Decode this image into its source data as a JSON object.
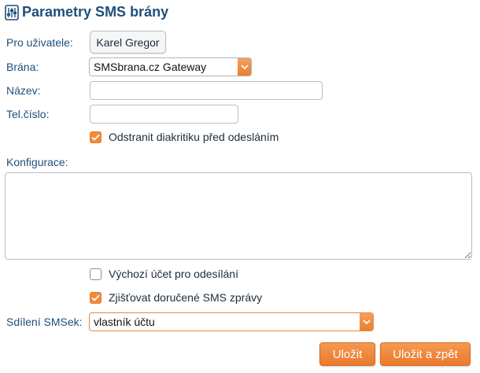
{
  "header": {
    "title": "Parametry SMS brány",
    "icon": "sliders-icon"
  },
  "form": {
    "user": {
      "label": "Pro uživatele:",
      "value": "Karel Gregor"
    },
    "gateway": {
      "label": "Brána:",
      "selected": "SMSbrana.cz Gateway"
    },
    "name": {
      "label": "Název:",
      "value": ""
    },
    "phone": {
      "label": "Tel.číslo:",
      "value": ""
    },
    "remove_diacritics": {
      "label": "Odstranit diakritiku před odesláním",
      "checked": true
    },
    "configuration": {
      "label": "Konfigurace:",
      "value": ""
    },
    "default_account": {
      "label": "Výchozí účet pro odesílání",
      "checked": false
    },
    "track_delivered": {
      "label": "Zjišťovat doručené SMS zprávy",
      "checked": true
    },
    "sharing": {
      "label": "Sdílení SMSek:",
      "selected": "vlastník účtu"
    }
  },
  "buttons": {
    "save": "Uložit",
    "save_back": "Uložit a zpět"
  },
  "colors": {
    "accent": "#f08a3c",
    "label_blue": "#1f4f7a"
  }
}
